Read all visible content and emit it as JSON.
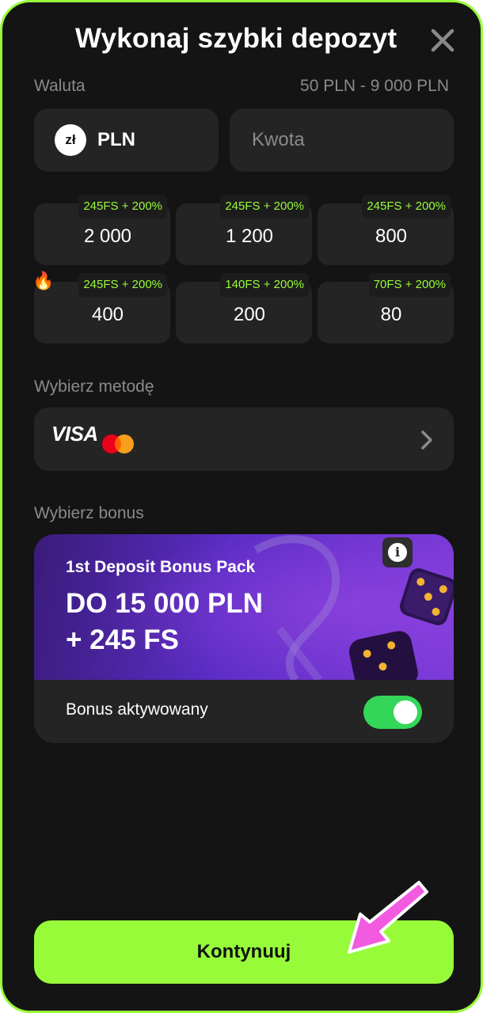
{
  "header": {
    "title": "Wykonaj szybki depozyt",
    "close_icon": "close-icon"
  },
  "currency": {
    "label": "Waluta",
    "range": "50 PLN - 9 000 PLN",
    "symbol": "zł",
    "code": "PLN",
    "amount_placeholder": "Kwota",
    "amount_value": ""
  },
  "presets": [
    {
      "value": "2 000",
      "tag": "245FS + 200%",
      "hot": false
    },
    {
      "value": "1 200",
      "tag": "245FS + 200%",
      "hot": false
    },
    {
      "value": "800",
      "tag": "245FS + 200%",
      "hot": false
    },
    {
      "value": "400",
      "tag": "245FS + 200%",
      "hot": true
    },
    {
      "value": "200",
      "tag": "140FS + 200%",
      "hot": false
    },
    {
      "value": "80",
      "tag": "70FS + 200%",
      "hot": false
    }
  ],
  "method": {
    "label": "Wybierz metodę",
    "visa": "VISA",
    "icons": [
      "visa-logo",
      "mastercard-logo",
      "chevron-right-icon"
    ]
  },
  "bonus": {
    "label": "Wybierz bonus",
    "subtitle": "1st Deposit Bonus Pack",
    "line1": "DO 15 000 PLN",
    "line2": "+ 245 FS",
    "status_label": "Bonus aktywowany",
    "active": true,
    "info_icon": "info-icon"
  },
  "cta": {
    "label": "Kontynuuj"
  },
  "colors": {
    "accent": "#98fb3a",
    "background": "#141414",
    "surface": "#242424",
    "toggle_on": "#34d65a",
    "banner_purple": "#5a2cc4",
    "pointer_arrow": "#f25adf"
  }
}
